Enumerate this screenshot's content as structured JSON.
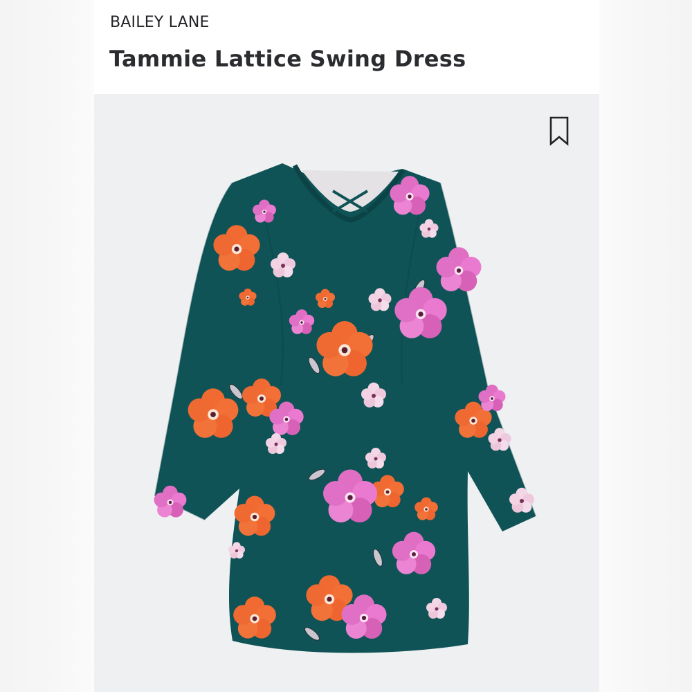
{
  "product": {
    "brand": "BAILEY LANE",
    "title": "Tammie Lattice Swing Dress"
  },
  "icons": {
    "bookmark": "bookmark-icon"
  },
  "colors": {
    "dress_teal": "#0f5356",
    "flower_orange": "#f06a32",
    "flower_pink": "#e474c8",
    "image_background": "#eef0f2"
  }
}
